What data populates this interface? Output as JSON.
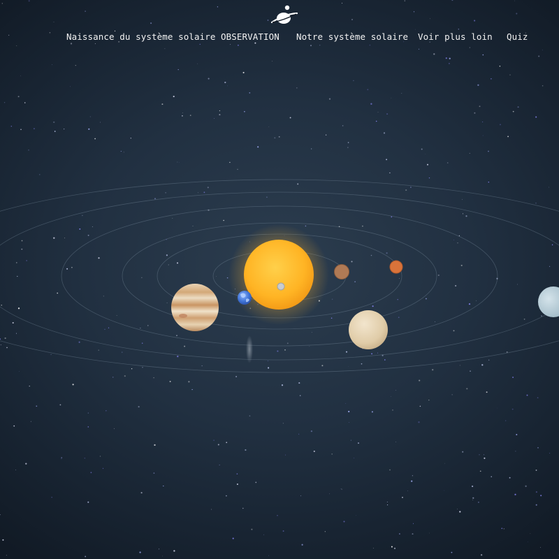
{
  "header": {
    "logo_icon": "planet-astronaut-icon"
  },
  "nav": {
    "items": [
      {
        "label": "Naissance du système solaire"
      },
      {
        "label": "OBSERVATION"
      },
      {
        "label": "Notre système solaire"
      },
      {
        "label": "Voir plus loin"
      },
      {
        "label": "Quiz"
      }
    ]
  },
  "scene": {
    "background_color": "#1e2b3a",
    "sun_color": "#ffb52e",
    "bodies": [
      "sun",
      "mercury",
      "venus",
      "earth",
      "mars",
      "jupiter",
      "saturn",
      "uranus"
    ]
  }
}
